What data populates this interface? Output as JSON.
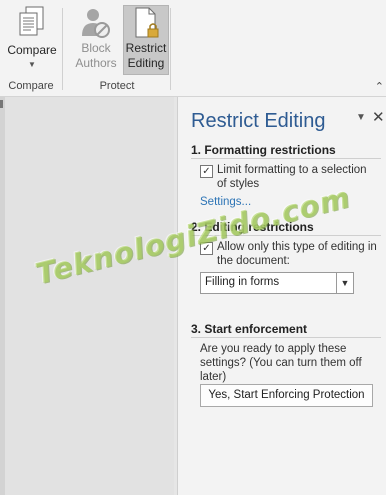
{
  "ribbon": {
    "compare_button": "Compare",
    "block_authors_line1": "Block",
    "block_authors_line2": "Authors",
    "restrict_line1": "Restrict",
    "restrict_line2": "Editing",
    "group_compare": "Compare",
    "group_protect": "Protect"
  },
  "pane": {
    "title": "Restrict Editing",
    "section1": "1. Formatting restrictions",
    "limit_formatting": "Limit formatting to a selection of styles",
    "settings_link": "Settings...",
    "section2": "2. Editing restrictions",
    "allow_only": "Allow only this type of editing in the document:",
    "editing_type": "Filling in forms",
    "section3": "3. Start enforcement",
    "enforce_question": "Are you ready to apply these settings? (You can turn them off later)",
    "enforce_button": "Yes, Start Enforcing Protection"
  },
  "watermark": "TeknologiZido.com",
  "colors": {
    "pane_title": "#2e5b92",
    "link": "#2e75b6",
    "watermark": "#add45f"
  }
}
